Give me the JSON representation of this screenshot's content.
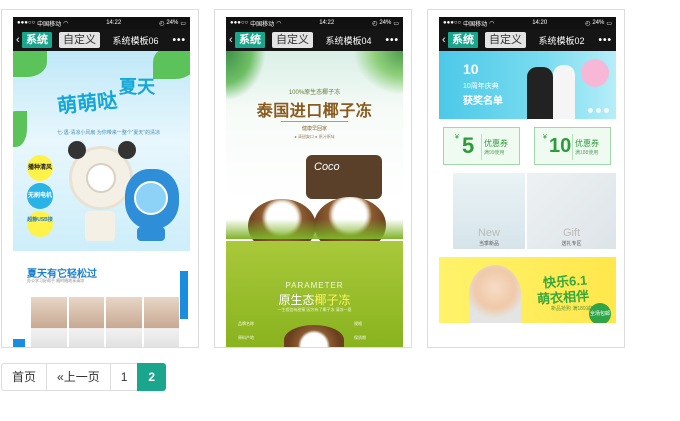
{
  "brand_color": "#1aa58d",
  "templates": [
    {
      "status": {
        "carrier": "中国移动",
        "time": "14:22",
        "battery": "24%"
      },
      "badge_system": "系统",
      "badge_custom": "自定义",
      "nav_title": "系统模板06",
      "content": {
        "headline_a": "萌萌哒",
        "headline_b": "夏天",
        "subline": "七·遇·清凉小风扇 为你带来一整个“夏天”的清凉",
        "bubbles": [
          "播种清风",
          "无刷电机",
          "超静USB接"
        ],
        "section_title": "夏天有它轻松过",
        "section_sub": "办公学习好帮手 随时随地享清凉"
      }
    },
    {
      "status": {
        "carrier": "中国移动",
        "time": "14:22",
        "battery": "24%"
      },
      "badge_system": "系统",
      "badge_custom": "自定义",
      "nav_title": "系统模板04",
      "content": {
        "eng": "100%原生态椰子冻",
        "title": "泰国进口椰子冻",
        "sub": "健康早回家",
        "sub2": "● 清甜爽口    ● 原汁原味",
        "brand": "Coco",
        "param": "PARAMETER",
        "param_title_a": "原生态",
        "param_title_b": "椰子冻",
        "param_sub": "一生相信有甜蜜 因为有了椰子冻 清凉一夏",
        "specs": [
          "品牌名称",
          "规格",
          "原料产地",
          "保质期"
        ]
      }
    },
    {
      "status": {
        "carrier": "中国移动",
        "time": "14:20",
        "battery": "24%"
      },
      "badge_system": "系统",
      "badge_custom": "自定义",
      "nav_title": "系统模板02",
      "content": {
        "banner_num": "10",
        "banner_line1": "10周年庆典",
        "banner_line2": "获奖名单",
        "coupons": [
          {
            "amount": "5",
            "name": "优惠券",
            "desc": "满99使用"
          },
          {
            "amount": "10",
            "name": "优惠券",
            "desc": "满188使用"
          }
        ],
        "photos": [
          {
            "label": "New",
            "sub": "当季新品"
          },
          {
            "label": "Gift",
            "sub": "送礼专区"
          }
        ],
        "promo_a": "快乐6.1",
        "promo_b": "萌衣相伴",
        "promo_c": "新品抢购 满189减50",
        "promo_badge": "全场包邮"
      }
    }
  ],
  "pagination": {
    "first": "首页",
    "prev": "«上一页",
    "pages": [
      "1",
      "2"
    ],
    "current": "2"
  }
}
